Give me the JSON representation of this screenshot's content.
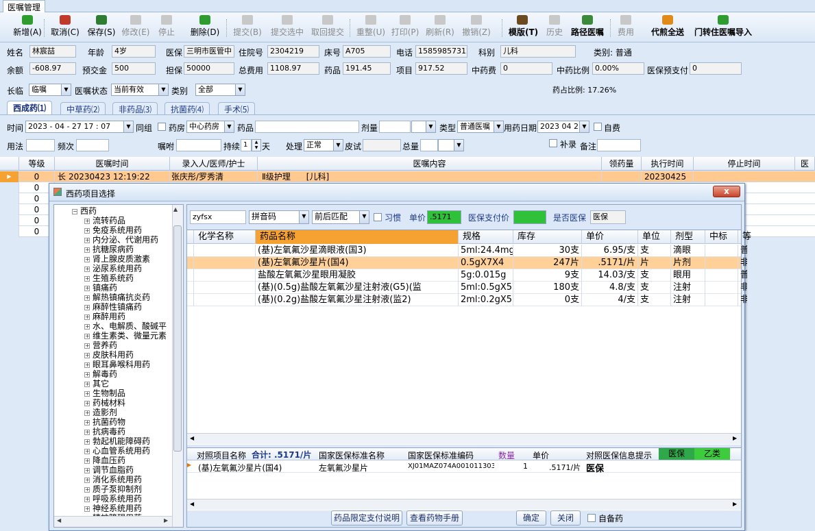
{
  "window": {
    "tab": "医嘱管理"
  },
  "toolbar": [
    {
      "label": "新增(A)",
      "icon": "add-icon",
      "color": "#2f9c2f",
      "enabled": true
    },
    {
      "label": "取消(C)",
      "icon": "undo-icon",
      "color": "#c0392b",
      "enabled": true
    },
    {
      "label": "保存(S)",
      "icon": "save-icon",
      "color": "#2e7d32",
      "enabled": true
    },
    {
      "label": "修改(E)",
      "icon": "edit-icon",
      "color": "#999",
      "enabled": false
    },
    {
      "label": "停止",
      "icon": "stop-icon",
      "color": "#999",
      "enabled": false
    },
    {
      "label": "删除(D)",
      "icon": "delete-icon",
      "color": "#2f9c2f",
      "enabled": true
    },
    {
      "label": "提交(B)",
      "icon": "submit-icon",
      "color": "#999",
      "enabled": false
    },
    {
      "label": "提交选中",
      "icon": "submit-selected-icon",
      "color": "#999",
      "enabled": false
    },
    {
      "label": "取回提交",
      "icon": "retrieve-icon",
      "color": "#999",
      "enabled": false
    },
    {
      "label": "重整(U)",
      "icon": "reorganize-icon",
      "color": "#999",
      "enabled": false
    },
    {
      "label": "打印(P)",
      "icon": "print-icon",
      "color": "#999",
      "enabled": false
    },
    {
      "label": "刷新(R)",
      "icon": "refresh-icon",
      "color": "#999",
      "enabled": false
    },
    {
      "label": "撤销(Z)",
      "icon": "revoke-icon",
      "color": "#999",
      "enabled": false
    },
    {
      "label": "模版(T)",
      "icon": "template-icon",
      "color": "#6b4a1f",
      "enabled": true,
      "bold": true
    },
    {
      "label": "历史",
      "icon": "history-icon",
      "color": "#999",
      "enabled": false
    },
    {
      "label": "路径医嘱",
      "icon": "path-icon",
      "color": "#3a8a3a",
      "enabled": true,
      "bold": true
    },
    {
      "label": "费用",
      "icon": "fee-icon",
      "color": "#999",
      "enabled": false
    },
    {
      "label": "代煎全送",
      "icon": "decoct-icon",
      "color": "#e08a1a",
      "enabled": true,
      "bold": true
    },
    {
      "label": "门转住医嘱导入",
      "icon": "import-icon",
      "color": "#2f9c2f",
      "enabled": true,
      "bold": true
    }
  ],
  "patient": {
    "name_label": "姓名",
    "name": "林宸喆",
    "age_label": "年龄",
    "age": "4岁",
    "insurance_label": "医保",
    "insurance": "三明市医管中",
    "inpatient_no_label": "住院号",
    "inpatient_no": "2304219",
    "bed_label": "床号",
    "bed": "A705",
    "phone_label": "电话",
    "phone": "15859857312",
    "dept_label": "科别",
    "dept": "儿科",
    "category": "类别: 普通",
    "balance_label": "余额",
    "balance": "-608.97",
    "prepay_label": "预交金",
    "prepay": "500",
    "guarantee_label": "担保",
    "guarantee": "50000",
    "total_label": "总费用",
    "total": "1108.97",
    "drug_label": "药品",
    "drug": "191.45",
    "item_label": "项目",
    "item": "917.52",
    "tcm_label": "中药费",
    "tcm": "0",
    "tcm_ratio_label": "中药比例",
    "tcm_ratio": "0.00%",
    "ins_prepay_label": "医保预支付",
    "ins_prepay": "0"
  },
  "filter": {
    "long_label": "长临",
    "long_value": "临嘱",
    "status_label": "医嘱状态",
    "status_value": "当前有效",
    "type_label": "类别",
    "type_value": "全部",
    "drug_ratio": "药占比例: 17.26%"
  },
  "subtabs": [
    "西成药⑴",
    "中草药⑵",
    "非药品⑶",
    "抗菌药⑷",
    "手术⑸"
  ],
  "form": {
    "time_label": "时间",
    "time_value": "2023 - 04 - 27    17 : 07",
    "group_label": "同组",
    "pharmacy_label": "药房",
    "pharmacy_value": "中心药房",
    "drug_label": "药品",
    "dose_label": "剂量",
    "kind_label": "类型",
    "kind_value": "普通医嘱",
    "date_label": "用药日期",
    "date_value": "2023 04 27",
    "self_pay_label": "自费",
    "usage_label": "用法",
    "freq_label": "频次",
    "instruction_label": "嘱咐",
    "duration_label": "持续",
    "duration_value": "1",
    "duration_unit": "天",
    "process_label": "处理",
    "process_value": "正常",
    "skin_test_label": "皮试",
    "total_label": "总量",
    "supplement_label": "补录",
    "remark_label": "备注"
  },
  "grid": {
    "headers": [
      "等级",
      "医嘱时间",
      "录入人/医师/护士",
      "医嘱内容",
      "领药量",
      "执行时间",
      "停止时间",
      "医"
    ],
    "rows": [
      {
        "level": "0",
        "kind": "长",
        "time": "20230423 12:19:22",
        "person": "张庆彤/罗秀清",
        "content": "Ⅱ级护理      [儿科]",
        "exec": "20230425"
      },
      {
        "level": "0"
      },
      {
        "level": "0"
      },
      {
        "level": "0"
      },
      {
        "level": "0"
      },
      {
        "level": "0"
      }
    ]
  },
  "dialog": {
    "title": "西药项目选择",
    "close": "x",
    "tree_root": "西药",
    "tree": [
      "流转药品",
      "免疫系统用药",
      "内分泌、代谢用药",
      "抗糖尿病药",
      "肾上腺皮质激素",
      "泌尿系统用药",
      "生殖系统药",
      "镇痛药",
      "解热镇痛抗炎药",
      "麻醉性镇痛药",
      "麻醉用药",
      "水、电解质、酸碱平",
      "维生素类、微量元素",
      "营养药",
      "皮肤科用药",
      "眼耳鼻喉科用药",
      "解毒药",
      "其它",
      "生物制品",
      "药械材料",
      "造影剂",
      "抗菌药物",
      "抗病毒药",
      "勃起机能障碍药",
      "心血管系统用药",
      "降血压药",
      "调节血脂药",
      "消化系统用药",
      "质子泵抑制剂",
      "呼吸系统用药",
      "神经系统用药",
      "精神障碍用药"
    ],
    "search": "zyfsx",
    "search_mode": "拼音码",
    "match_mode": "前后匹配",
    "habit_label": "习惯",
    "price_label": "单价",
    "price_value": ".5171",
    "ins_price_label": "医保支付价",
    "is_ins_label": "是否医保",
    "is_ins_value": "医保",
    "headers": [
      "化学名称",
      "药品名称",
      "规格",
      "库存",
      "单价",
      "单位",
      "剂型",
      "中标",
      "等"
    ],
    "rows": [
      {
        "chem": "",
        "name": "(基)左氧氟沙星滴眼液(国3)",
        "spec": "5ml:24.4mg",
        "stock": "30支",
        "price": "6.95/支",
        "unit": "支",
        "form": "滴眼",
        "bid": "",
        "grade": "普"
      },
      {
        "chem": "",
        "name": "(基)左氧氟沙星片(国4)",
        "spec": "0.5gX7X4",
        "stock": "247片",
        "price": ".5171/片",
        "unit": "片",
        "form": "片剂",
        "bid": "",
        "grade": "非"
      },
      {
        "chem": "",
        "name": "盐酸左氧氟沙星眼用凝胶",
        "spec": "5g:0.015g",
        "stock": "9支",
        "price": "14.03/支",
        "unit": "支",
        "form": "眼用",
        "bid": "",
        "grade": "普"
      },
      {
        "chem": "",
        "name": "(基)(0.5g)盐酸左氧氟沙星注射液(G5)(监",
        "spec": "5ml:0.5gX5",
        "stock": "180支",
        "price": "4.8/支",
        "unit": "支",
        "form": "注射",
        "bid": "",
        "grade": "非"
      },
      {
        "chem": "",
        "name": "(基)(0.2g)盐酸左氧氟沙星注射液(监2)",
        "spec": "2ml:0.2gX5",
        "stock": "0支",
        "price": "4/支",
        "unit": "支",
        "form": "注射",
        "bid": "",
        "grade": "非"
      }
    ],
    "lower_headers": {
      "item_name": "对照项目名称",
      "sum": "合计: .5171/片",
      "std_name": "国家医保标准名称",
      "std_code": "国家医保标准编码",
      "qty": "数量",
      "price": "单价",
      "hint": "对照医保信息提示",
      "ins": "医保",
      "class": "乙类"
    },
    "lower_row": {
      "item_name": "(基)左氧氟沙星片(国4)",
      "std_name": "左氧氟沙星片",
      "std_code": "XJ01MAZ074A0010113033",
      "qty": "1",
      "price": ".5171/片",
      "ins": "医保"
    },
    "buttons": {
      "limit": "药品限定支付说明",
      "manual": "查看药物手册",
      "ok": "确定",
      "close": "关闭",
      "self_prepared": "自备药"
    }
  }
}
